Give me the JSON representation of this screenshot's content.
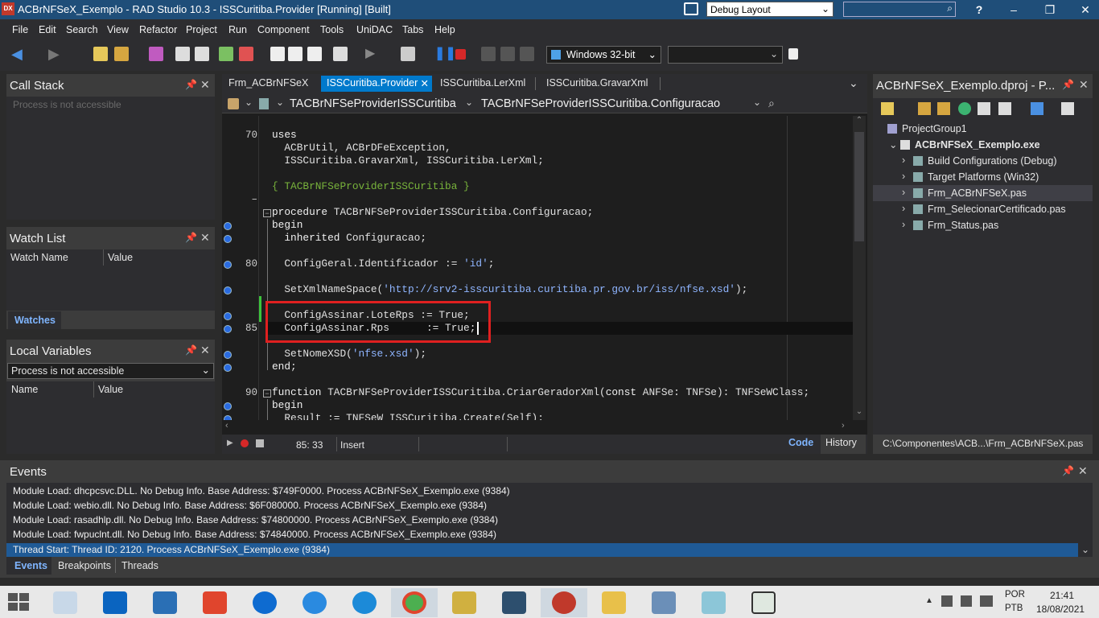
{
  "app": {
    "title": "ACBrNFSeX_Exemplo - RAD Studio 10.3 - ISSCuritiba.Provider [Running] [Built]",
    "logo_text": "DX",
    "layout_selector": "Debug Layout",
    "help_label": "?"
  },
  "menu": [
    "File",
    "Edit",
    "Search",
    "View",
    "Refactor",
    "Project",
    "Run",
    "Component",
    "Tools",
    "UniDAC",
    "Tabs",
    "Help"
  ],
  "toolbar": {
    "platform": "Windows 32-bit",
    "config": ""
  },
  "call_stack": {
    "title": "Call Stack",
    "placeholder": "Process is not accessible"
  },
  "watch_list": {
    "title": "Watch List",
    "columns": [
      "Watch Name",
      "Value"
    ],
    "tab": "Watches"
  },
  "local_variables": {
    "title": "Local Variables",
    "selector": "Process is not accessible",
    "columns": [
      "Name",
      "Value"
    ]
  },
  "editor": {
    "tabs": [
      "Frm_ACBrNFSeX",
      "ISSCuritiba.Provider",
      "ISSCuritiba.LerXml",
      "ISSCuritiba.GravarXml"
    ],
    "active_tab": 1,
    "class_nav": "TACBrNFSeProviderISSCuritiba",
    "method_nav": "TACBrNFSeProviderISSCuritiba.Configuracao",
    "lines": [
      {
        "ln": "70",
        "bp": false,
        "segs": [
          {
            "t": "uses",
            "c": "kw"
          }
        ]
      },
      {
        "ln": "",
        "bp": false,
        "segs": [
          {
            "t": "  ACBrUtil, ACBrDFeException,",
            "c": ""
          }
        ]
      },
      {
        "ln": "",
        "bp": false,
        "segs": [
          {
            "t": "  ISSCuritiba.GravarXml, ISSCuritiba.LerXml;",
            "c": ""
          }
        ]
      },
      {
        "ln": "",
        "bp": false,
        "segs": [
          {
            "t": "",
            "c": ""
          }
        ]
      },
      {
        "ln": "",
        "bp": false,
        "segs": [
          {
            "t": "{ TACBrNFSeProviderISSCuritiba }",
            "c": "cmt"
          }
        ]
      },
      {
        "ln": "–",
        "bp": false,
        "segs": [
          {
            "t": "",
            "c": ""
          }
        ]
      },
      {
        "ln": "",
        "bp": false,
        "segs": [
          {
            "t": "procedure",
            "c": "kw"
          },
          {
            "t": " TACBrNFSeProviderISSCuritiba.Configuracao;",
            "c": ""
          }
        ]
      },
      {
        "ln": "",
        "bp": true,
        "segs": [
          {
            "t": "begin",
            "c": "kw"
          }
        ]
      },
      {
        "ln": "",
        "bp": true,
        "segs": [
          {
            "t": "  inherited",
            "c": "kw"
          },
          {
            "t": " Configuracao;",
            "c": ""
          }
        ]
      },
      {
        "ln": "",
        "bp": false,
        "segs": [
          {
            "t": "",
            "c": ""
          }
        ]
      },
      {
        "ln": "80",
        "bp": true,
        "segs": [
          {
            "t": "  ConfigGeral.Identificador := ",
            "c": ""
          },
          {
            "t": "'id'",
            "c": "str"
          },
          {
            "t": ";",
            "c": ""
          }
        ]
      },
      {
        "ln": "",
        "bp": false,
        "segs": [
          {
            "t": "",
            "c": ""
          }
        ]
      },
      {
        "ln": "",
        "bp": true,
        "segs": [
          {
            "t": "  SetXmlNameSpace(",
            "c": ""
          },
          {
            "t": "'http://srv2-isscuritiba.curitiba.pr.gov.br/iss/nfse.xsd'",
            "c": "str"
          },
          {
            "t": ");",
            "c": ""
          }
        ]
      },
      {
        "ln": "",
        "bp": false,
        "segs": [
          {
            "t": "",
            "c": ""
          }
        ]
      },
      {
        "ln": "",
        "bp": true,
        "segs": [
          {
            "t": "  ConfigAssinar.LoteRps := True;",
            "c": ""
          }
        ]
      },
      {
        "ln": "85",
        "bp": true,
        "segs": [
          {
            "t": "  ConfigAssinar.Rps      := True;",
            "c": ""
          }
        ]
      },
      {
        "ln": "",
        "bp": false,
        "segs": [
          {
            "t": "",
            "c": ""
          }
        ]
      },
      {
        "ln": "",
        "bp": true,
        "segs": [
          {
            "t": "  SetNomeXSD(",
            "c": ""
          },
          {
            "t": "'nfse.xsd'",
            "c": "str"
          },
          {
            "t": ");",
            "c": ""
          }
        ]
      },
      {
        "ln": "",
        "bp": true,
        "segs": [
          {
            "t": "end",
            "c": "kw"
          },
          {
            "t": ";",
            "c": ""
          }
        ]
      },
      {
        "ln": "",
        "bp": false,
        "segs": [
          {
            "t": "",
            "c": ""
          }
        ]
      },
      {
        "ln": "90",
        "bp": false,
        "segs": [
          {
            "t": "function",
            "c": "kw"
          },
          {
            "t": " TACBrNFSeProviderISSCuritiba.CriarGeradorXml(",
            "c": ""
          },
          {
            "t": "const",
            "c": "kw"
          },
          {
            "t": " ANFSe: TNFSe): TNFSeWClass;",
            "c": ""
          }
        ]
      },
      {
        "ln": "",
        "bp": true,
        "segs": [
          {
            "t": "begin",
            "c": "kw"
          }
        ]
      },
      {
        "ln": "",
        "bp": true,
        "segs": [
          {
            "t": "  Result := TNFSeW_ISSCuritiba.Create(Self);",
            "c": ""
          }
        ]
      }
    ],
    "status": {
      "position": "85: 33",
      "mode": "Insert",
      "code_tab": "Code",
      "history_tab": "History"
    }
  },
  "project": {
    "title": "ACBrNFSeX_Exemplo.dproj - P...",
    "tree": [
      {
        "label": "ProjectGroup1",
        "indent": 0,
        "bold": false,
        "arrow": ""
      },
      {
        "label": "ACBrNFSeX_Exemplo.exe",
        "indent": 1,
        "bold": true,
        "arrow": "v"
      },
      {
        "label": "Build Configurations (Debug)",
        "indent": 2,
        "bold": false,
        "arrow": ">"
      },
      {
        "label": "Target Platforms (Win32)",
        "indent": 2,
        "bold": false,
        "arrow": ">"
      },
      {
        "label": "Frm_ACBrNFSeX.pas",
        "indent": 2,
        "bold": false,
        "arrow": ">",
        "selected": true
      },
      {
        "label": "Frm_SelecionarCertificado.pas",
        "indent": 2,
        "bold": false,
        "arrow": ">"
      },
      {
        "label": "Frm_Status.pas",
        "indent": 2,
        "bold": false,
        "arrow": ">"
      }
    ],
    "path": "C:\\Componentes\\ACB...\\Frm_ACBrNFSeX.pas"
  },
  "events": {
    "title": "Events",
    "lines": [
      "Module Load: dhcpcsvc.DLL. No Debug Info. Base Address: $749F0000. Process ACBrNFSeX_Exemplo.exe (9384)",
      "Module Load: webio.dll. No Debug Info. Base Address: $6F080000. Process ACBrNFSeX_Exemplo.exe (9384)",
      "Module Load: rasadhlp.dll. No Debug Info. Base Address: $74800000. Process ACBrNFSeX_Exemplo.exe (9384)",
      "Module Load: fwpuclnt.dll. No Debug Info. Base Address: $74840000. Process ACBrNFSeX_Exemplo.exe (9384)",
      "Thread Start: Thread ID: 2120. Process ACBrNFSeX_Exemplo.exe (9384)"
    ],
    "tabs": [
      "Events",
      "Breakpoints",
      "Threads"
    ]
  },
  "taskbar": {
    "apps": [
      "start-icon",
      "task-manager-icon",
      "outlook-icon",
      "anydesk-icon",
      "git-icon",
      "teamviewer-icon",
      "ie-icon",
      "edge-icon",
      "chrome-icon",
      "tools-icon",
      "mysql-icon",
      "delphi-icon",
      "file-explorer-icon",
      "remote-desktop-icon",
      "notepad-icon",
      "app-window-icon"
    ],
    "lang_top": "POR",
    "lang_bottom": "PTB",
    "time": "21:41",
    "date": "18/08/2021"
  }
}
